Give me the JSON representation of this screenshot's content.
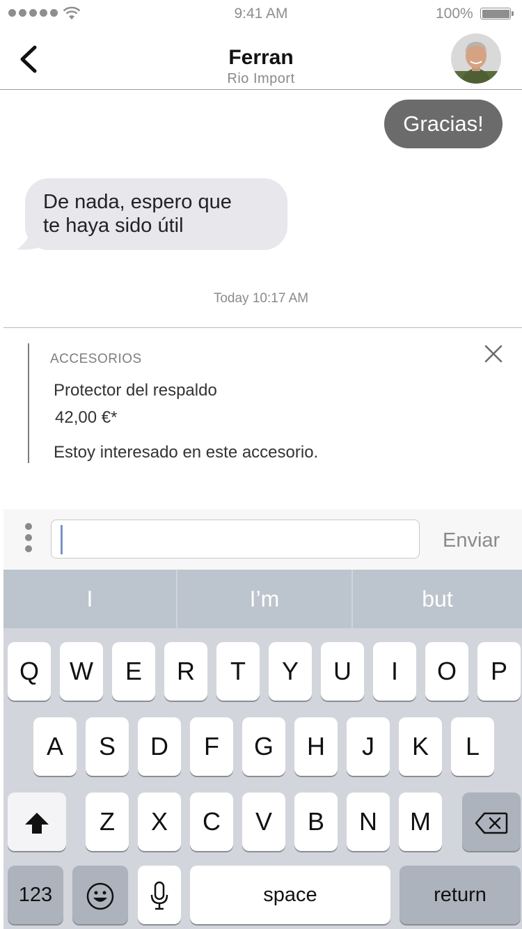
{
  "status_bar": {
    "time": "9:41 AM",
    "battery": "100%"
  },
  "nav": {
    "title": "Ferran",
    "subtitle": "Rio Import"
  },
  "messages": {
    "outgoing": "Gracias!",
    "incoming_line1": "De nada, espero  que",
    "incoming_line2": "te haya sido útil",
    "timestamp": "Today 10:17 AM"
  },
  "accessory": {
    "category": "ACCESORIOS",
    "name": "Protector del respaldo",
    "price": "42,00 €*",
    "message": "Estoy interesado en este accesorio."
  },
  "composer": {
    "value": "",
    "send_label": "Enviar"
  },
  "keyboard": {
    "suggestions": [
      "I",
      "I’m",
      "but"
    ],
    "row1": [
      "Q",
      "W",
      "E",
      "R",
      "T",
      "Y",
      "U",
      "I",
      "O",
      "P"
    ],
    "row2": [
      "A",
      "S",
      "D",
      "F",
      "G",
      "H",
      "J",
      "K",
      "L"
    ],
    "row3": [
      "Z",
      "X",
      "C",
      "V",
      "B",
      "N",
      "M"
    ],
    "numbers_label": "123",
    "space_label": "space",
    "return_label": "return"
  },
  "icons": {
    "back": "chevron-left-icon",
    "close": "close-icon",
    "menu": "vertical-dots-icon",
    "shift": "shift-arrow-icon",
    "delete": "backspace-icon",
    "emoji": "emoji-icon",
    "mic": "microphone-icon"
  }
}
